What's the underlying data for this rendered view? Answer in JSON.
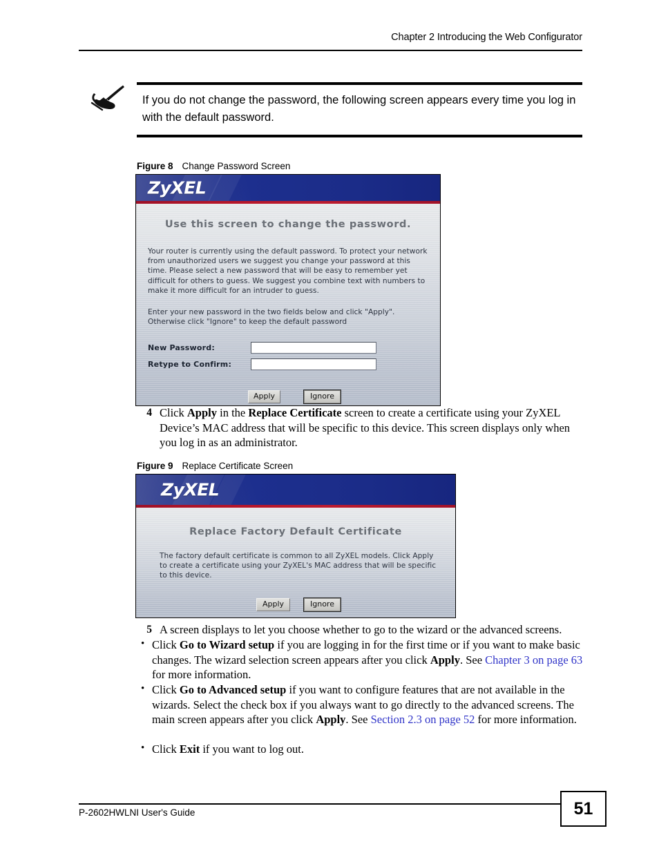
{
  "header": {
    "chapter_title": "Chapter 2 Introducing the Web Configurator"
  },
  "note": {
    "icon": "note-pen-hand-icon",
    "text": "If you do not change the password, the following screen appears every time you log in with the default password."
  },
  "figure8": {
    "caption_label": "Figure 8",
    "caption_title": "Change Password Screen",
    "screen": {
      "logo": "ZyXEL",
      "heading": "Use this screen to change the password.",
      "paragraph1": "Your router is currently using the default password. To protect your network from unauthorized users we suggest you change your password at this time. Please select a new password that will be easy to remember yet difficult for others to guess. We suggest you combine text with numbers to make it more difficult for an intruder to guess.",
      "paragraph2": "Enter your new password in the two fields below and click \"Apply\". Otherwise click \"Ignore\" to keep the default password",
      "fields": [
        {
          "label": "New Password:",
          "value": ""
        },
        {
          "label": "Retype to Confirm:",
          "value": ""
        }
      ],
      "buttons": [
        {
          "label": "Apply"
        },
        {
          "label": "Ignore"
        }
      ]
    }
  },
  "step4": {
    "number": "4",
    "parts": [
      {
        "text": "Click ",
        "style": "normal"
      },
      {
        "text": "Apply",
        "style": "bold"
      },
      {
        "text": " in the ",
        "style": "normal"
      },
      {
        "text": "Replace Certificate",
        "style": "bold"
      },
      {
        "text": " screen to create a certificate using your ZyXEL Device’s MAC address that will be specific to this device. This screen displays only when you log in as an administrator.",
        "style": "normal"
      }
    ]
  },
  "figure9": {
    "caption_label": "Figure 9",
    "caption_title": "Replace Certificate Screen",
    "screen": {
      "logo": "ZyXEL",
      "heading": "Replace Factory Default Certificate",
      "paragraph1": "The factory default certificate is common to all ZyXEL models. Click Apply to create a certificate using your ZyXEL's MAC address that will be specific to this device.",
      "buttons": [
        {
          "label": "Apply"
        },
        {
          "label": "Ignore"
        }
      ]
    }
  },
  "step5": {
    "number": "5",
    "text": "A screen displays to let you choose whether to go to the wizard or the advanced screens."
  },
  "bullets": [
    {
      "marker": "•",
      "parts": [
        {
          "text": "Click ",
          "style": "normal"
        },
        {
          "text": "Go to Wizard setup",
          "style": "bold"
        },
        {
          "text": " if you are logging in for the first time or if you want to make basic changes. The wizard selection screen appears after you click ",
          "style": "normal"
        },
        {
          "text": "Apply",
          "style": "bold"
        },
        {
          "text": ". See ",
          "style": "normal"
        },
        {
          "text": "Chapter 3 on page 63",
          "style": "link"
        },
        {
          "text": " for more information.",
          "style": "normal"
        }
      ]
    },
    {
      "marker": "•",
      "parts": [
        {
          "text": "Click ",
          "style": "normal"
        },
        {
          "text": "Go to Advanced setup",
          "style": "bold"
        },
        {
          "text": " if you want to configure features that are not available in the wizards. Select the check box if you always want to go directly to the advanced screens. The main screen appears after you click ",
          "style": "normal"
        },
        {
          "text": "Apply",
          "style": "bold"
        },
        {
          "text": ". See ",
          "style": "normal"
        },
        {
          "text": "Section 2.3 on page 52",
          "style": "link"
        },
        {
          "text": " for more information.",
          "style": "normal"
        }
      ]
    },
    {
      "marker": "•",
      "parts": [
        {
          "text": "Click ",
          "style": "normal"
        },
        {
          "text": "Exit",
          "style": "bold"
        },
        {
          "text": " if you want to log out.",
          "style": "normal"
        }
      ]
    }
  ],
  "footer": {
    "guide_name": "P-2602HWLNI User's Guide",
    "page_number": "51"
  },
  "colors": {
    "banner_blue": "#1d2f8e",
    "banner_red": "#b41428",
    "link_blue": "#2f33c8",
    "screen_heading_gray": "#6a6f76"
  }
}
